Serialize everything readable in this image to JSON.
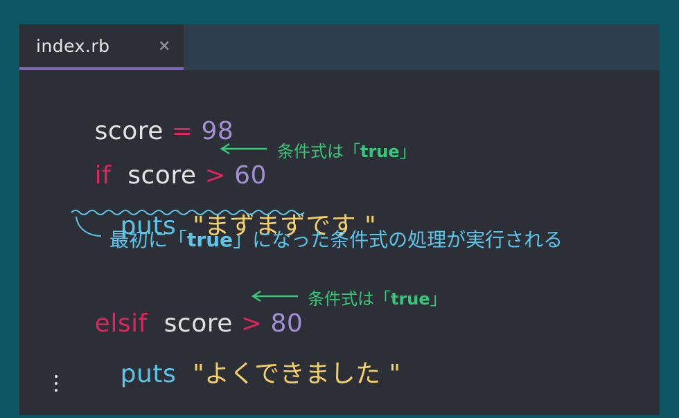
{
  "tab": {
    "filename": "index.rb",
    "close": "×"
  },
  "code": {
    "line1": {
      "var": "score",
      "op": "=",
      "num": "98"
    },
    "line2": {
      "kw": "if",
      "var": "score",
      "op": ">",
      "num": "60"
    },
    "line3": {
      "fn": "puts",
      "str": "\"まずまずです \""
    },
    "line4": {
      "kw": "elsif",
      "var": "score",
      "op": ">",
      "num": "80"
    },
    "line5": {
      "fn": "puts",
      "str": "\"よくできました \""
    }
  },
  "annotations": {
    "note1": {
      "prefix": "条件式は「",
      "value": "true",
      "suffix": "」"
    },
    "note2": {
      "prefix": "条件式は「",
      "value": "true",
      "suffix": "」"
    },
    "callout": {
      "prefix": "最初に「",
      "value": "true",
      "suffix": "」になった条件式の処理が実行される"
    }
  },
  "colors": {
    "background": "#0d5663",
    "editor": "#2c2f35",
    "tabbar": "#2d3e4d",
    "tab_accent": "#7e62b5",
    "keyword": "#e0245e",
    "number": "#a38fd6",
    "function": "#5cc6ea",
    "string": "#f2d06b",
    "annotation_green": "#36c77a"
  }
}
